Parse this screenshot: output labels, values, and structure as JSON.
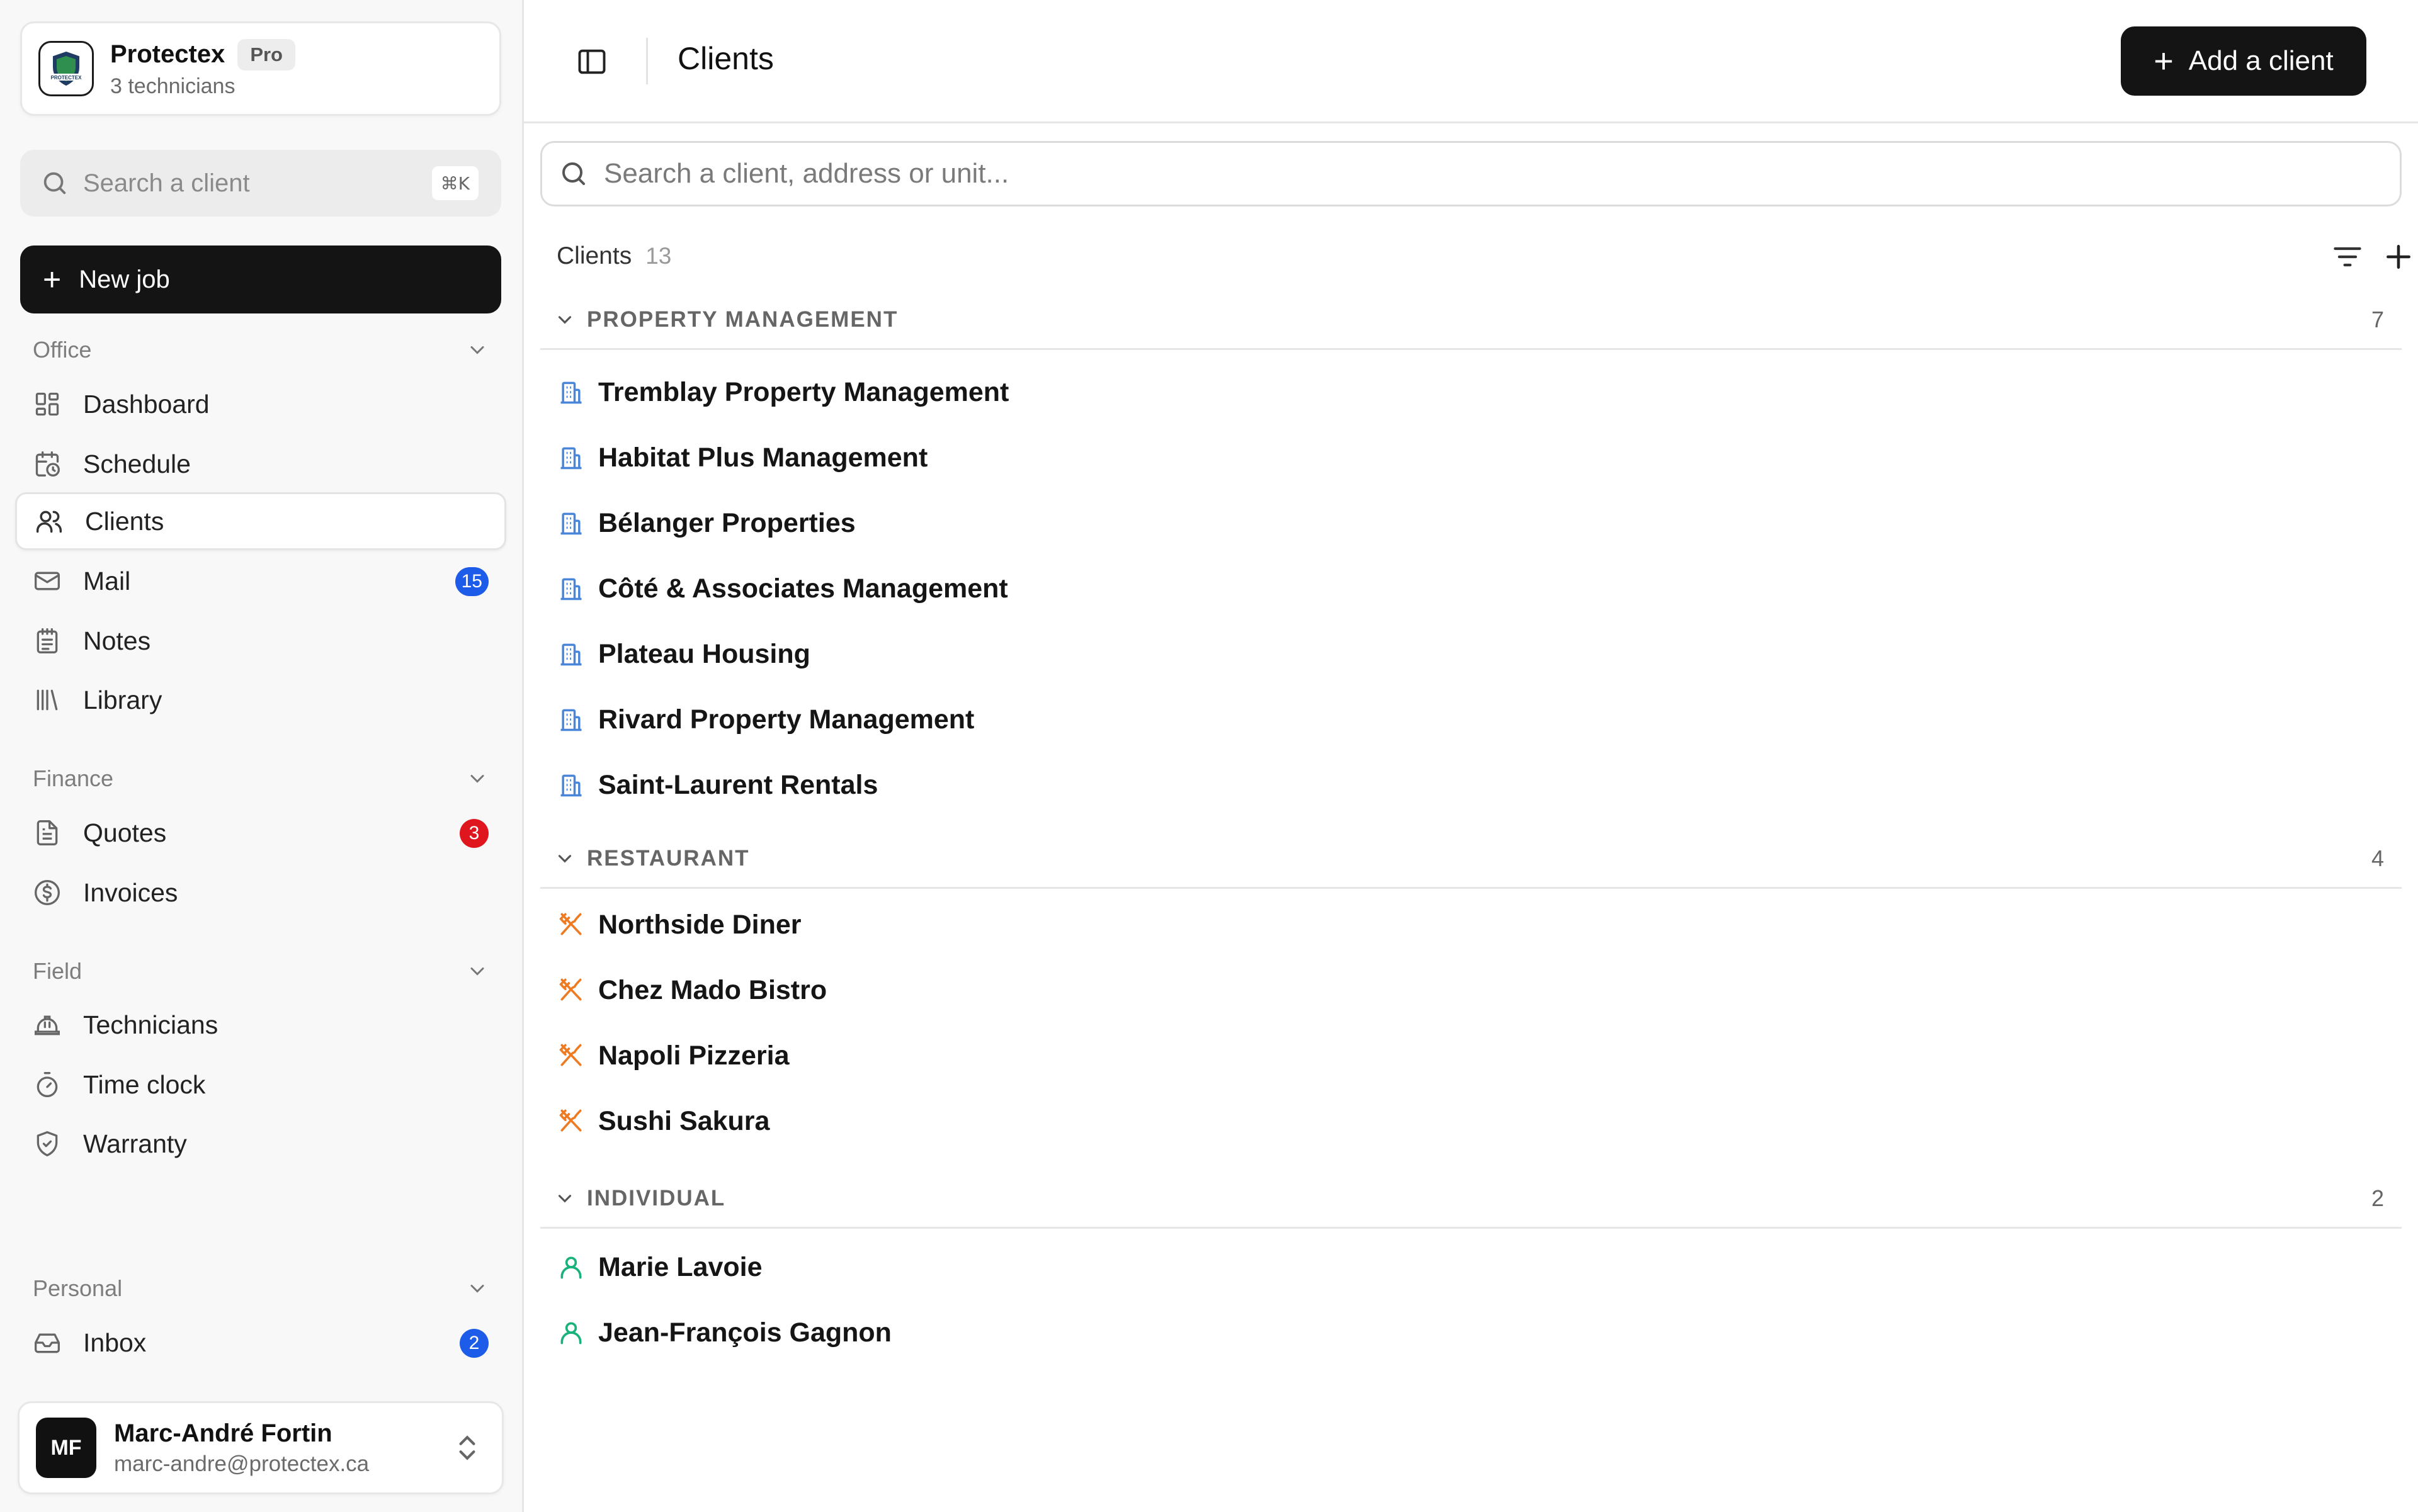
{
  "org": {
    "name": "Protectex",
    "plan": "Pro",
    "subtitle": "3 technicians",
    "logo_text": "PROTECTEX"
  },
  "sidebar": {
    "search_placeholder": "Search a client",
    "search_shortcut": "⌘K",
    "new_job_label": "New job",
    "sections": {
      "office": {
        "title": "Office",
        "items": [
          {
            "label": "Dashboard",
            "icon": "dashboard-icon"
          },
          {
            "label": "Schedule",
            "icon": "calendar-clock-icon"
          },
          {
            "label": "Clients",
            "icon": "users-icon",
            "active": true
          },
          {
            "label": "Mail",
            "icon": "mail-icon",
            "badge": "15"
          },
          {
            "label": "Notes",
            "icon": "notes-icon"
          },
          {
            "label": "Library",
            "icon": "library-icon"
          }
        ]
      },
      "finance": {
        "title": "Finance",
        "items": [
          {
            "label": "Quotes",
            "icon": "document-icon",
            "badge": "3"
          },
          {
            "label": "Invoices",
            "icon": "dollar-circle-icon"
          }
        ]
      },
      "field": {
        "title": "Field",
        "items": [
          {
            "label": "Technicians",
            "icon": "hard-hat-icon"
          },
          {
            "label": "Time clock",
            "icon": "stopwatch-icon"
          },
          {
            "label": "Warranty",
            "icon": "shield-check-icon"
          }
        ]
      },
      "personal": {
        "title": "Personal",
        "items": [
          {
            "label": "Inbox",
            "icon": "inbox-icon",
            "badge": "2"
          }
        ]
      }
    },
    "user": {
      "initials": "MF",
      "name": "Marc-André Fortin",
      "email": "marc-andre@protectex.ca"
    }
  },
  "main": {
    "title": "Clients",
    "add_button": "Add a client",
    "search_placeholder": "Search a client, address or unit...",
    "list_label": "Clients",
    "list_count": "13",
    "groups": [
      {
        "name": "PROPERTY MANAGEMENT",
        "count": "7",
        "icon": "building-icon",
        "clients": [
          "Tremblay Property Management",
          "Habitat Plus Management",
          "Bélanger Properties",
          "Côté & Associates Management",
          "Plateau Housing",
          "Rivard Property Management",
          "Saint-Laurent Rentals"
        ]
      },
      {
        "name": "RESTAURANT",
        "count": "4",
        "icon": "utensils-icon",
        "clients": [
          "Northside Diner",
          "Chez Mado Bistro",
          "Napoli Pizzeria",
          "Sushi Sakura"
        ]
      },
      {
        "name": "INDIVIDUAL",
        "count": "2",
        "icon": "person-icon",
        "clients": [
          "Marie Lavoie",
          "Jean-François Gagnon"
        ]
      }
    ]
  },
  "colors": {
    "primary_button": "#141414",
    "badge_blue": "#1d5ce8",
    "badge_red": "#e0161f",
    "building_icon": "#4a86d8",
    "restaurant_icon": "#ee7a22",
    "individual_icon": "#19b27a"
  }
}
